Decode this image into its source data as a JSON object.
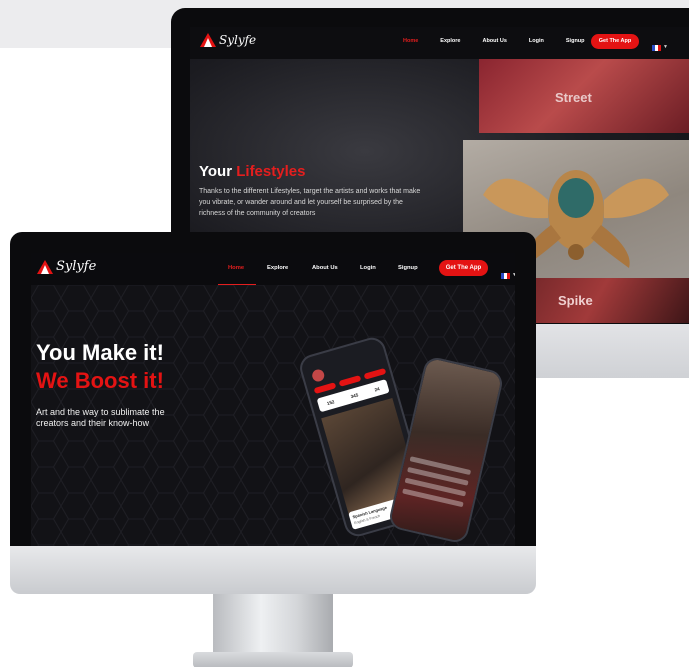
{
  "back_site": {
    "logo": "Sylyfe",
    "nav": [
      {
        "label": "Home",
        "active": true
      },
      {
        "label": "Explore",
        "active": false
      },
      {
        "label": "About Us",
        "active": false
      },
      {
        "label": "Login",
        "active": false
      },
      {
        "label": "Signup",
        "active": false
      }
    ],
    "cta": "Get The App",
    "hero": {
      "heading_white": "Your",
      "heading_red": "Lifestyles",
      "paragraph": "Thanks to the different Lifestyles, target the artists and works that make you vibrate, or wander around and let yourself be surprised by the richness of the community of creators"
    },
    "tiles": [
      "Street",
      "Spike"
    ]
  },
  "front_site": {
    "logo": "Sylyfe",
    "nav": [
      {
        "label": "Home",
        "active": true
      },
      {
        "label": "Explore",
        "active": false
      },
      {
        "label": "About Us",
        "active": false
      },
      {
        "label": "Login",
        "active": false
      },
      {
        "label": "Signup",
        "active": false
      }
    ],
    "cta": "Get The App",
    "hero": {
      "line1": "You Make it!",
      "line2": "We Boost it!",
      "paragraph": "Art and the way to sublimate the creators and their know-how"
    },
    "phone": {
      "stats": [
        "152",
        "345",
        "24"
      ],
      "card_title": "Spanish Language",
      "card_sub": "English & French"
    }
  },
  "colors": {
    "accent": "#e41313",
    "background": "#0f0f12"
  },
  "icons": [
    "logo-flame-icon",
    "flag-fr-icon",
    "chevron-down-icon"
  ]
}
